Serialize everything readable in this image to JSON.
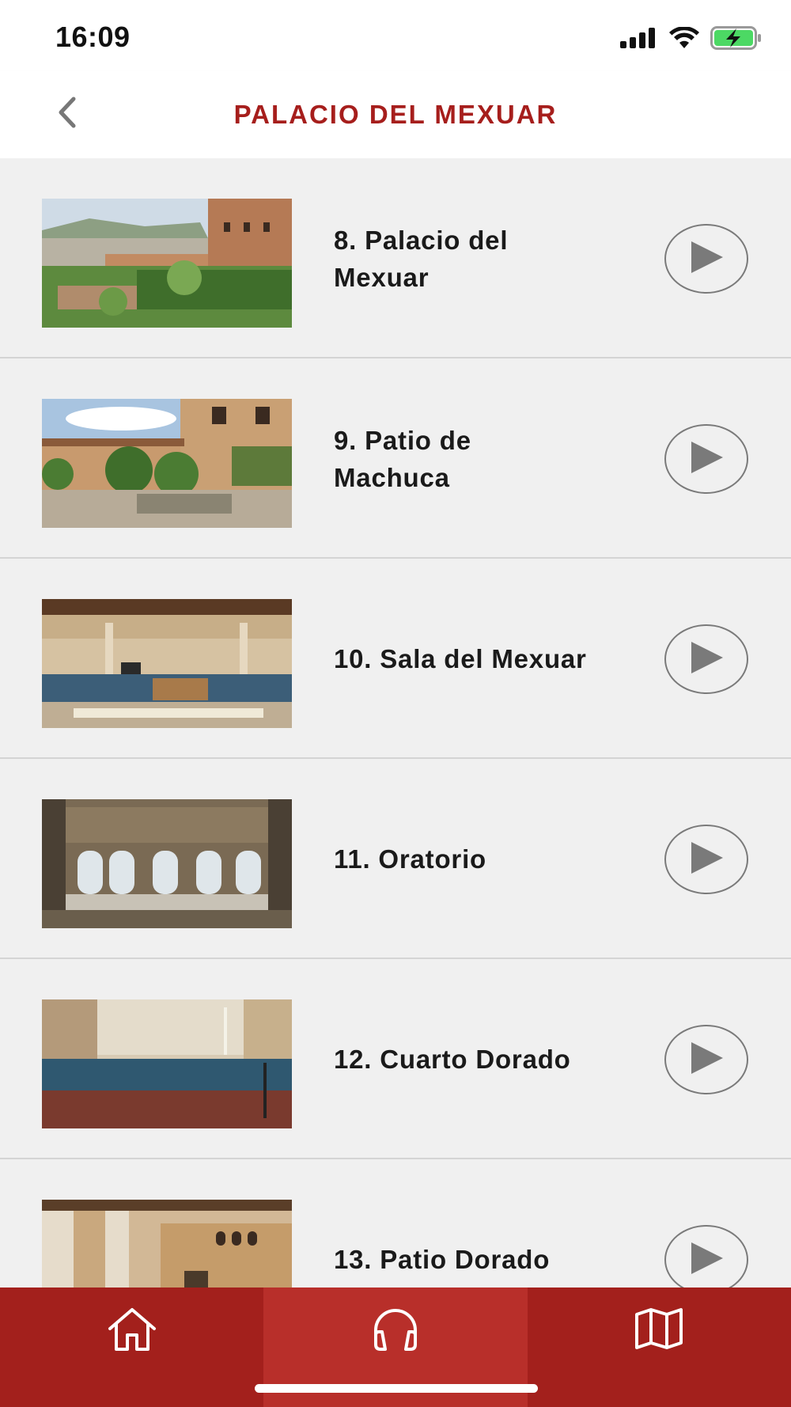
{
  "status_bar": {
    "time": "16:09",
    "battery_color": "#4cd964"
  },
  "header": {
    "title": "PALACIO DEL MEXUAR",
    "back_icon": "chevron-left-icon",
    "title_color": "#a61e1c"
  },
  "list": {
    "items": [
      {
        "title": "8. Palacio del Mexuar"
      },
      {
        "title": "9. Patio de Machuca"
      },
      {
        "title": "10. Sala del Mexuar"
      },
      {
        "title": "11. Oratorio"
      },
      {
        "title": "12. Cuarto Dorado"
      },
      {
        "title": "13. Patio Dorado"
      }
    ],
    "play_icon": "play-icon"
  },
  "tab_bar": {
    "tabs": [
      {
        "icon": "home-icon",
        "active": false
      },
      {
        "icon": "headphones-icon",
        "active": true
      },
      {
        "icon": "map-icon",
        "active": false
      }
    ],
    "background": "#a3201c",
    "active_background": "#b82f2a"
  }
}
